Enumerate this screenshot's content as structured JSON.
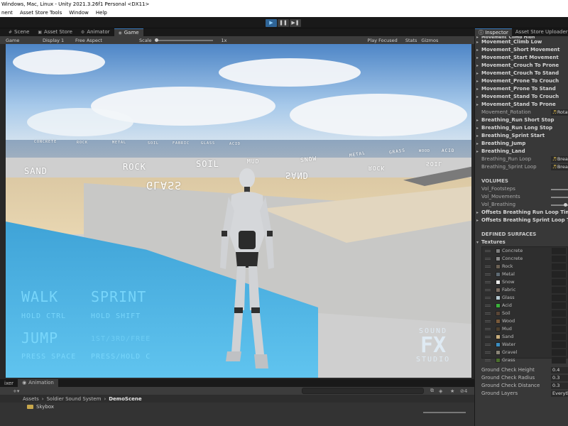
{
  "window": {
    "title": "Windows, Mac, Linux - Unity 2021.3.26f1 Personal <DX11>"
  },
  "menu": [
    "nent",
    "Asset Store Tools",
    "Window",
    "Help"
  ],
  "toolbar": {
    "play_icon": "▶",
    "pause_icon": "❚❚",
    "step_icon": "▶❚"
  },
  "scene_tabs": [
    {
      "label": "Scene",
      "icon": "#"
    },
    {
      "label": "Asset Store",
      "icon": "▣"
    },
    {
      "label": "Animator",
      "icon": "⚙"
    },
    {
      "label": "Game",
      "icon": "◉"
    }
  ],
  "gamebar": {
    "game_dropdown": "Game",
    "display": "Display 1",
    "aspect": "Free Aspect",
    "scale_label": "Scale",
    "scale_value": "1x",
    "play_focused": "Play Focused",
    "stats": "Stats",
    "gizmos": "Gizmos"
  },
  "viewport": {
    "labels_left": [
      "SAND",
      "ROCK",
      "SOIL",
      "MUD",
      "SNOW"
    ],
    "glass_label": "GLASS",
    "labels_right": [
      "SAND",
      "ROCK",
      "METAL",
      "GRASS",
      "SOIL",
      "WOOD",
      "ACID"
    ],
    "far_labels": [
      "CONCRETE",
      "ROCK",
      "METAL",
      "SOIL",
      "FABRIC",
      "GLASS",
      "ACID"
    ],
    "hud": {
      "walk": "WALK",
      "walk_hint": "HOLD CTRL",
      "sprint": "SPRINT",
      "sprint_hint": "HOLD SHIFT",
      "jump": "JUMP",
      "jump_hint": "PRESS SPACE",
      "view": "1ST/3RD/FREE",
      "view_hint": "PRESS/HOLD C"
    },
    "logo_line1": "SOUND",
    "logo_line2": "FX",
    "logo_line3": "STUDIO"
  },
  "bottom_tabs": [
    {
      "label": "ixer"
    },
    {
      "label": "Animation",
      "icon": "◉"
    }
  ],
  "project_bar": {
    "count": "4",
    "search_placeholder": ""
  },
  "breadcrumb": {
    "root": "Assets",
    "mid": "Soldier Sound System",
    "current": "DemoScene"
  },
  "project_items": [
    {
      "label": "Skybox"
    }
  ],
  "inspector": {
    "tabs": [
      "Inspector",
      "Asset Store Uploader"
    ],
    "top_cut": "Movement_Climb High",
    "movement_items": [
      "Movement_Climb Low",
      "Movement_Short Movement",
      "Movement_Start Movement",
      "Movement_Crouch To Prone",
      "Movement_Crouch To Stand",
      "Movement_Prone To Crouch",
      "Movement_Prone To Stand",
      "Movement_Stand To Crouch",
      "Movement_Stand To Prone"
    ],
    "rotation_label": "Movement_Rotation",
    "rotation_value": "Rotat",
    "breathing_items": [
      "Breathing_Run Short Stop",
      "Breathing_Run Long Stop",
      "Breathing_Sprint Start",
      "Breathing_Jump",
      "Breathing_Land"
    ],
    "breathing_run_loop": {
      "label": "Breathing_Run Loop",
      "value": "Breat"
    },
    "breathing_sprint_loop": {
      "label": "Breathing_Sprint Loop",
      "value": "Breat"
    },
    "volumes_header": "VOLUMES",
    "volumes": [
      {
        "label": "Vol_Footsteps",
        "level": 1.0
      },
      {
        "label": "Vol_Movements",
        "level": 1.0
      },
      {
        "label": "Vol_Breathing",
        "level": 0.65
      }
    ],
    "offsets": [
      "Offsets Breathing Run Loop Time",
      "Offsets Breathing Sprint Loop Time"
    ],
    "surfaces_header": "DEFINED SURFACES",
    "textures_label": "Textures",
    "textures": [
      {
        "name": "Concrete",
        "color": "#7d7d7d"
      },
      {
        "name": "Concrete",
        "color": "#8a8a8a"
      },
      {
        "name": "Rock",
        "color": "#6b6154"
      },
      {
        "name": "Metal",
        "color": "#5e6a74"
      },
      {
        "name": "Snow",
        "color": "#e9e9e9"
      },
      {
        "name": "Fabric",
        "color": "#7b6d62"
      },
      {
        "name": "Glass",
        "color": "#b4c7cf"
      },
      {
        "name": "Acid",
        "color": "#3bb13b"
      },
      {
        "name": "Soil",
        "color": "#5a4636"
      },
      {
        "name": "Wood",
        "color": "#7a5a3a"
      },
      {
        "name": "Mud",
        "color": "#4d3f2e"
      },
      {
        "name": "Sand",
        "color": "#c9ae7c"
      },
      {
        "name": "Water",
        "color": "#3b8ec2"
      },
      {
        "name": "Gravel",
        "color": "#8b8578"
      },
      {
        "name": "Grass",
        "color": "#4b6e2d"
      }
    ],
    "ground_check": [
      {
        "label": "Ground Check Height",
        "value": "0.4"
      },
      {
        "label": "Ground Check Radius",
        "value": "0.3"
      },
      {
        "label": "Ground Check Distance",
        "value": "0.3"
      },
      {
        "label": "Ground Layers",
        "value": "Everythi"
      }
    ]
  }
}
